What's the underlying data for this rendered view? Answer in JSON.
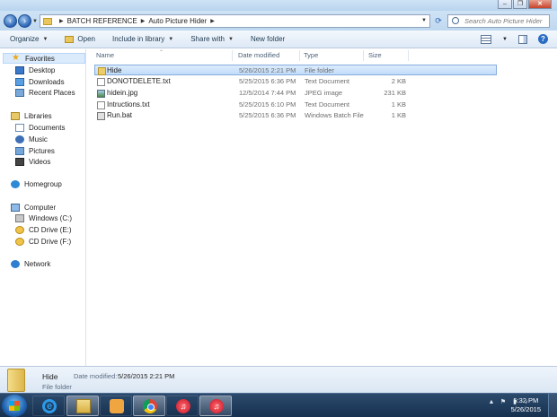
{
  "address": {
    "breadcrumb": [
      "BATCH REFERENCE",
      "Auto Picture Hider"
    ],
    "search_placeholder": "Search Auto Picture Hider"
  },
  "toolbar": {
    "organize": "Organize",
    "open": "Open",
    "include_in_library": "Include in library",
    "share_with": "Share with",
    "new_folder": "New folder"
  },
  "navpane": {
    "favorites": "Favorites",
    "desktop": "Desktop",
    "downloads": "Downloads",
    "recent_places": "Recent Places",
    "libraries": "Libraries",
    "documents": "Documents",
    "music": "Music",
    "pictures": "Pictures",
    "videos": "Videos",
    "homegroup": "Homegroup",
    "computer": "Computer",
    "windows_c": "Windows (C:)",
    "cd_e": "CD Drive (E:)",
    "cd_f": "CD Drive (F:)",
    "network": "Network"
  },
  "columns": {
    "name": "Name",
    "date_modified": "Date modified",
    "type": "Type",
    "size": "Size"
  },
  "files": [
    {
      "name": "Hide",
      "date": "5/26/2015 2:21 PM",
      "type": "File folder",
      "size": "",
      "icon": "folder-icon"
    },
    {
      "name": "DONOTDELETE.txt",
      "date": "5/25/2015 6:36 PM",
      "type": "Text Document",
      "size": "2 KB",
      "icon": "text-file-icon"
    },
    {
      "name": "hidein.jpg",
      "date": "12/5/2014 7:44 PM",
      "type": "JPEG image",
      "size": "231 KB",
      "icon": "image-file-icon"
    },
    {
      "name": "Intructions.txt",
      "date": "5/25/2015 6:10 PM",
      "type": "Text Document",
      "size": "1 KB",
      "icon": "text-file-icon"
    },
    {
      "name": "Run.bat",
      "date": "5/25/2015 6:36 PM",
      "type": "Windows Batch File",
      "size": "1 KB",
      "icon": "batch-file-icon"
    }
  ],
  "details": {
    "name": "Hide",
    "modified_label": "Date modified:",
    "modified_value": "5/26/2015 2:21 PM",
    "type": "File folder"
  },
  "taskbar": {
    "time": "5:32 PM",
    "date": "5/26/2015"
  }
}
